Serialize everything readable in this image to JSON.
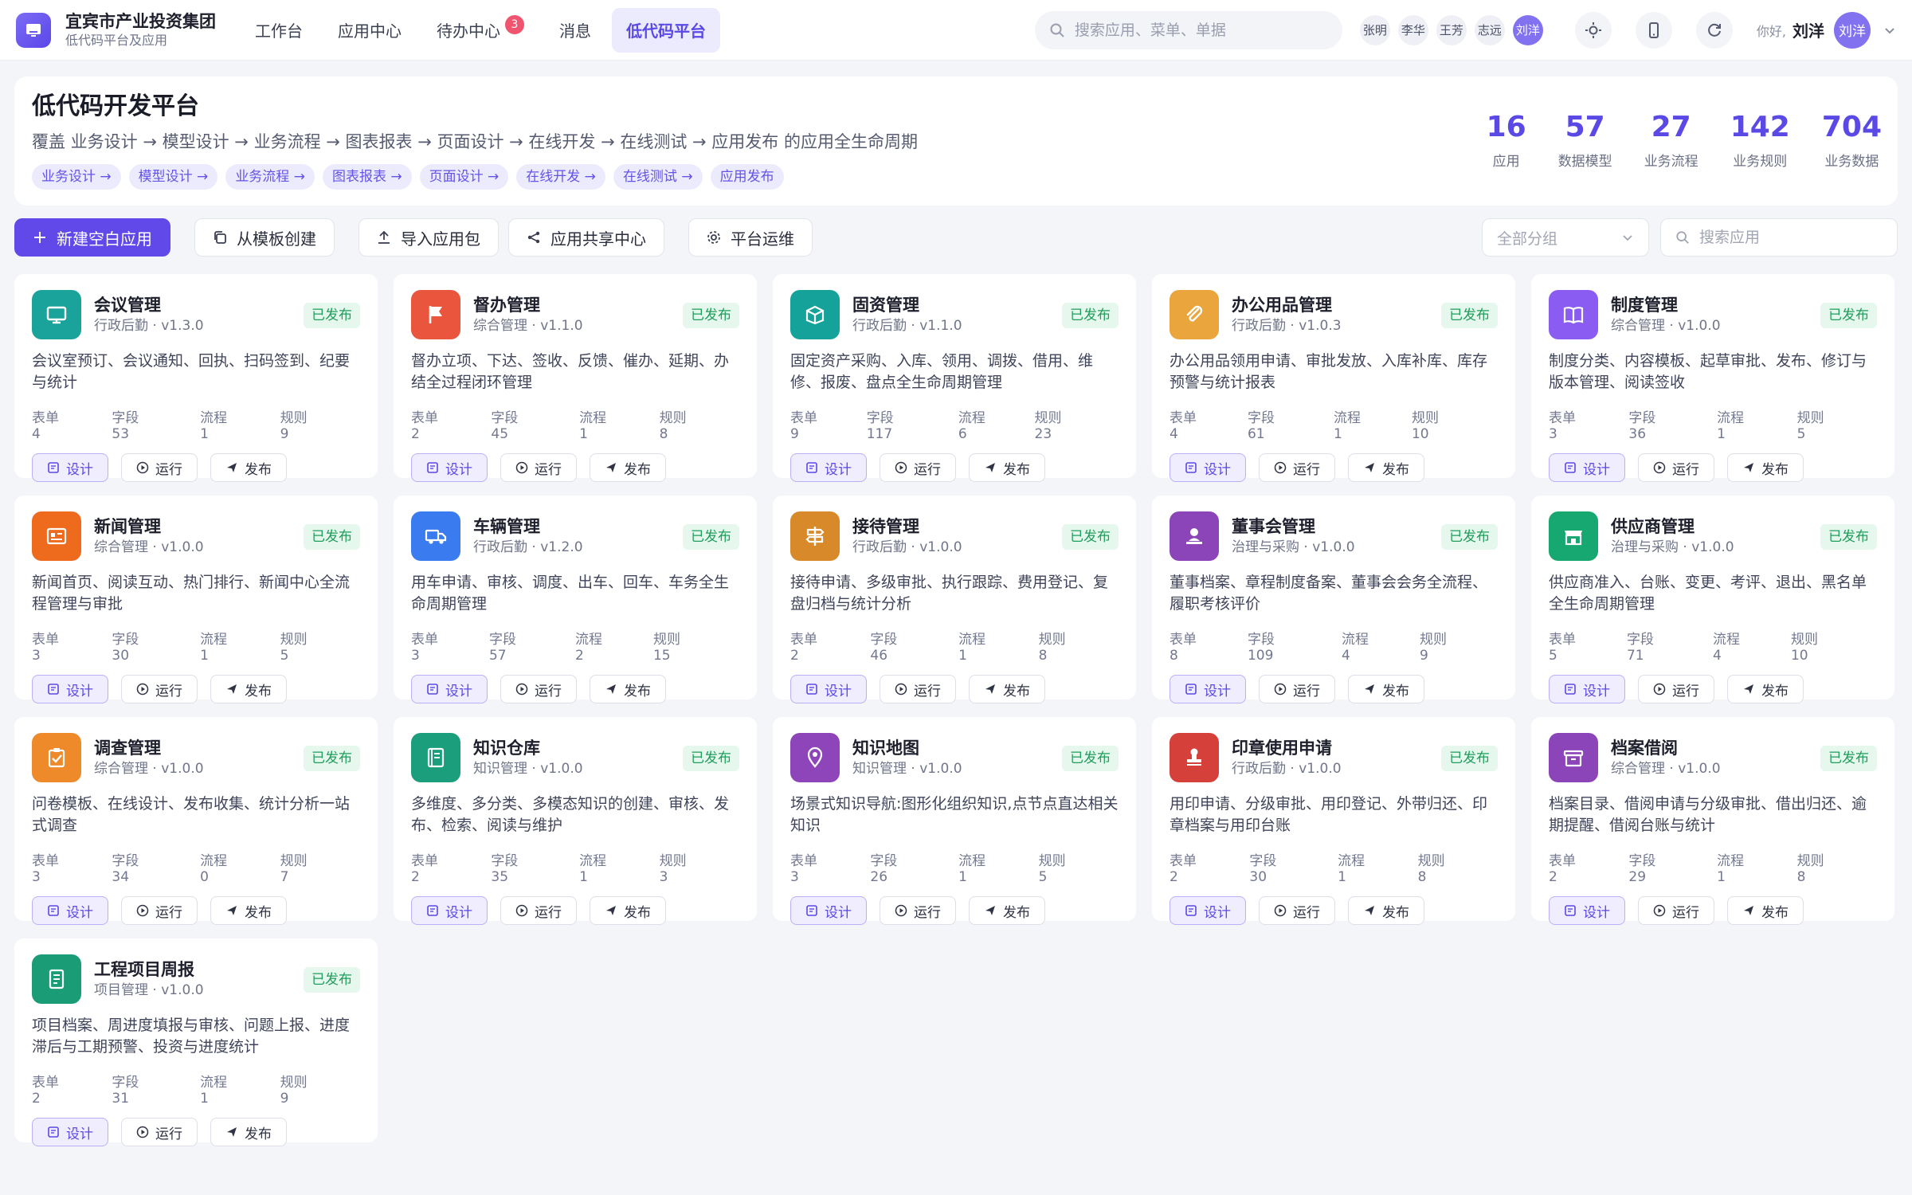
{
  "brand": {
    "name": "宜宾市产业投资集团",
    "subtitle": "低代码平台及应用"
  },
  "nav": [
    {
      "label": "工作台"
    },
    {
      "label": "应用中心"
    },
    {
      "label": "待办中心",
      "badge": "3"
    },
    {
      "label": "消息"
    },
    {
      "label": "低代码平台",
      "active": true
    }
  ],
  "search": {
    "placeholder": "搜索应用、菜单、单据"
  },
  "online_users": [
    "张明",
    "李华",
    "王芳",
    "志远",
    "刘洋"
  ],
  "header_icons": [
    "sun-icon",
    "mobile-icon",
    "refresh-icon"
  ],
  "user": {
    "greeting": "你好,",
    "name": "刘洋",
    "avatar": "刘洋"
  },
  "hero": {
    "title": "低代码开发平台",
    "description": "覆盖 业务设计 → 模型设计 → 业务流程 → 图表报表 → 页面设计 → 在线开发 → 在线测试 → 应用发布 的应用全生命周期",
    "tags": [
      "业务设计 →",
      "模型设计 →",
      "业务流程 →",
      "图表报表 →",
      "页面设计 →",
      "在线开发 →",
      "在线测试 →",
      "应用发布"
    ],
    "stats": [
      {
        "value": "16",
        "label": "应用"
      },
      {
        "value": "57",
        "label": "数据模型"
      },
      {
        "value": "27",
        "label": "业务流程"
      },
      {
        "value": "142",
        "label": "业务规则"
      },
      {
        "value": "704",
        "label": "业务数据"
      }
    ]
  },
  "toolbar": {
    "new_app": "新建空白应用",
    "from_template": "从模板创建",
    "import_pkg": "导入应用包",
    "share_center": "应用共享中心",
    "ops": "平台运维",
    "group_select": "全部分组",
    "search_placeholder": "搜索应用"
  },
  "actions": {
    "design": "设计",
    "run": "运行",
    "publish": "发布"
  },
  "count_labels": {
    "forms": "表单",
    "fields": "字段",
    "flows": "流程",
    "rules": "规则"
  },
  "colors": {
    "accent": "#6049e8",
    "published_bg": "#e6f7ee",
    "published_text": "#1e9e5a"
  },
  "apps": [
    {
      "name": "会议管理",
      "category": "行政后勤",
      "version": "v1.3.0",
      "status": "已发布",
      "desc": "会议室预订、会议通知、回执、扫码签到、纪要与统计",
      "forms": "4",
      "fields": "53",
      "flows": "1",
      "rules": "9",
      "icon": "monitor-icon",
      "color": "#1aa39b"
    },
    {
      "name": "督办管理",
      "category": "综合管理",
      "version": "v1.1.0",
      "status": "已发布",
      "desc": "督办立项、下达、签收、反馈、催办、延期、办结全过程闭环管理",
      "forms": "2",
      "fields": "45",
      "flows": "1",
      "rules": "8",
      "icon": "flag-icon",
      "color": "#ea553d"
    },
    {
      "name": "固资管理",
      "category": "行政后勤",
      "version": "v1.1.0",
      "status": "已发布",
      "desc": "固定资产采购、入库、领用、调拨、借用、维修、报废、盘点全生命周期管理",
      "forms": "9",
      "fields": "117",
      "flows": "6",
      "rules": "23",
      "icon": "box-icon",
      "color": "#15a29a"
    },
    {
      "name": "办公用品管理",
      "category": "行政后勤",
      "version": "v1.0.3",
      "status": "已发布",
      "desc": "办公用品领用申请、审批发放、入库补库、库存预警与统计报表",
      "forms": "4",
      "fields": "61",
      "flows": "1",
      "rules": "10",
      "icon": "paperclip-icon",
      "color": "#eaa63c"
    },
    {
      "name": "制度管理",
      "category": "综合管理",
      "version": "v1.0.0",
      "status": "已发布",
      "desc": "制度分类、内容模板、起草审批、发布、修订与版本管理、阅读签收",
      "forms": "3",
      "fields": "36",
      "flows": "1",
      "rules": "5",
      "icon": "book-icon",
      "color": "#8a5cf2"
    },
    {
      "name": "新闻管理",
      "category": "综合管理",
      "version": "v1.0.0",
      "status": "已发布",
      "desc": "新闻首页、阅读互动、热门排行、新闻中心全流程管理与审批",
      "forms": "3",
      "fields": "30",
      "flows": "1",
      "rules": "5",
      "icon": "news-icon",
      "color": "#ee6a1c"
    },
    {
      "name": "车辆管理",
      "category": "行政后勤",
      "version": "v1.2.0",
      "status": "已发布",
      "desc": "用车申请、审核、调度、出车、回车、车务全生命周期管理",
      "forms": "3",
      "fields": "57",
      "flows": "2",
      "rules": "15",
      "icon": "truck-icon",
      "color": "#3b7bf0"
    },
    {
      "name": "接待管理",
      "category": "行政后勤",
      "version": "v1.0.0",
      "status": "已发布",
      "desc": "接待申请、多级审批、执行跟踪、费用登记、复盘归档与统计分析",
      "forms": "2",
      "fields": "46",
      "flows": "1",
      "rules": "8",
      "icon": "signpost-icon",
      "color": "#d8892a"
    },
    {
      "name": "董事会管理",
      "category": "治理与采购",
      "version": "v1.0.0",
      "status": "已发布",
      "desc": "董事档案、章程制度备案、董事会会务全流程、履职考核评价",
      "forms": "8",
      "fields": "109",
      "flows": "4",
      "rules": "9",
      "icon": "user-seal-icon",
      "color": "#8c45b8"
    },
    {
      "name": "供应商管理",
      "category": "治理与采购",
      "version": "v1.0.0",
      "status": "已发布",
      "desc": "供应商准入、台账、变更、考评、退出、黑名单全生命周期管理",
      "forms": "5",
      "fields": "71",
      "flows": "4",
      "rules": "10",
      "icon": "store-icon",
      "color": "#16a870"
    },
    {
      "name": "调查管理",
      "category": "综合管理",
      "version": "v1.0.0",
      "status": "已发布",
      "desc": "问卷模板、在线设计、发布收集、统计分析一站式调查",
      "forms": "3",
      "fields": "34",
      "flows": "0",
      "rules": "7",
      "icon": "clipboard-check-icon",
      "color": "#ee8a2a"
    },
    {
      "name": "知识仓库",
      "category": "知识管理",
      "version": "v1.0.0",
      "status": "已发布",
      "desc": "多维度、多分类、多模态知识的创建、审核、发布、检索、阅读与维护",
      "forms": "2",
      "fields": "35",
      "flows": "1",
      "rules": "3",
      "icon": "notebook-icon",
      "color": "#1b9e7c"
    },
    {
      "name": "知识地图",
      "category": "知识管理",
      "version": "v1.0.0",
      "status": "已发布",
      "desc": "场景式知识导航:图形化组织知识,点节点直达相关知识",
      "forms": "3",
      "fields": "26",
      "flows": "1",
      "rules": "5",
      "icon": "map-pin-icon",
      "color": "#8e45b9"
    },
    {
      "name": "印章使用申请",
      "category": "行政后勤",
      "version": "v1.0.0",
      "status": "已发布",
      "desc": "用印申请、分级审批、用印登记、外带归还、印章档案与用印台账",
      "forms": "2",
      "fields": "30",
      "flows": "1",
      "rules": "8",
      "icon": "stamp-icon",
      "color": "#d6403a"
    },
    {
      "name": "档案借阅",
      "category": "综合管理",
      "version": "v1.0.0",
      "status": "已发布",
      "desc": "档案目录、借阅申请与分级审批、借出归还、逾期提醒、借阅台账与统计",
      "forms": "2",
      "fields": "29",
      "flows": "1",
      "rules": "8",
      "icon": "archive-icon",
      "color": "#8c45b8"
    },
    {
      "name": "工程项目周报",
      "category": "项目管理",
      "version": "v1.0.0",
      "status": "已发布",
      "desc": "项目档案、周进度填报与审核、问题上报、进度滞后与工期预警、投资与进度统计",
      "forms": "2",
      "fields": "31",
      "flows": "1",
      "rules": "9",
      "icon": "report-icon",
      "color": "#1a9d76"
    }
  ]
}
